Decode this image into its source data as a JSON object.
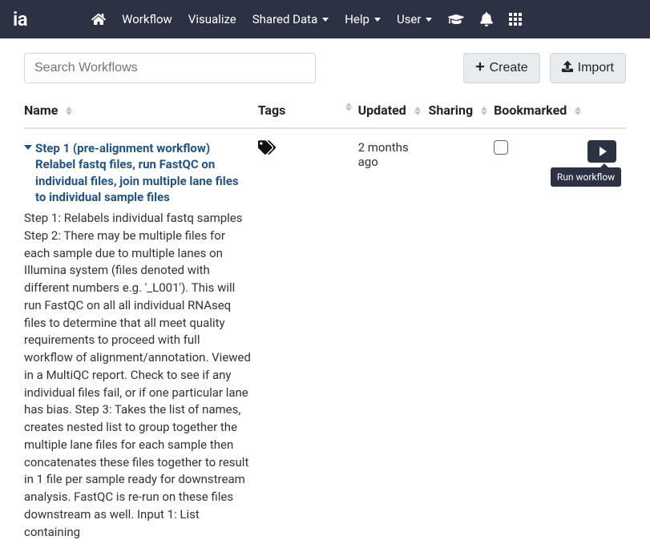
{
  "brand": "ia",
  "nav": {
    "workflow": "Workflow",
    "visualize": "Visualize",
    "shared_data": "Shared Data",
    "help": "Help",
    "user": "User"
  },
  "toolbar": {
    "search_placeholder": "Search Workflows",
    "create_label": "Create",
    "import_label": "Import"
  },
  "columns": {
    "name": "Name",
    "tags": "Tags",
    "updated": "Updated",
    "sharing": "Sharing",
    "bookmarked": "Bookmarked"
  },
  "rows": [
    {
      "title": "Step 1 (pre-alignment workflow) Relabel fastq files, run FastQC on individual files, join multiple lane files to individual sample files",
      "description": "Step 1: Relabels individual fastq samples Step 2: There may be multiple files for each sample due to multiple lanes on Illumina system (files denoted with different numbers e.g. '_L001'). This will run FastQC on all all individual RNAseq files to determine that all meet quality requirements to proceed with full workflow of alignment/annotation. Viewed in a MultiQC report. Check to see if any individual files fail, or if one particular lane has bias. Step 3: Takes the list of names, creates nested list to group together the multiple lane files for each sample then concatenates these files together to result in 1 file per sample ready for downstream analysis. FastQC is re-run on these files downstream as well. Input 1: List containing",
      "updated": "2 months ago",
      "bookmarked": false
    }
  ],
  "tooltip": {
    "run_workflow": "Run workflow"
  }
}
